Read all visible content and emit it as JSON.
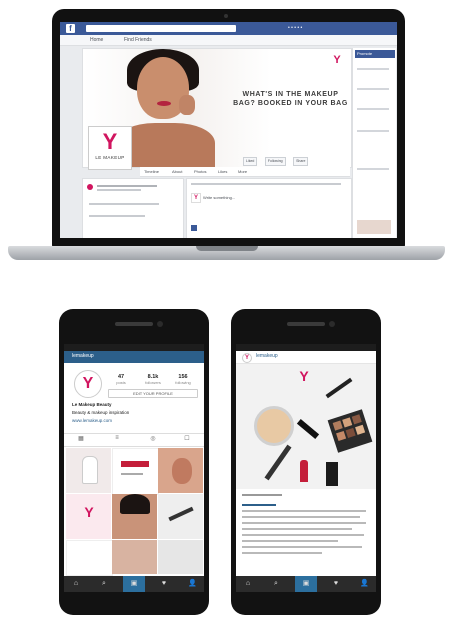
{
  "laptop": {
    "facebook": {
      "logo": "f",
      "headline": "WHAT'S IN THE MAKEUP BAG? BOOKED IN YOUR BAG",
      "brand_logo": "Y",
      "brand_name": "LE MAKEUP",
      "cover_buttons": [
        "Liked",
        "Following",
        "Share"
      ],
      "subnav": [
        "Home",
        "Find Friends"
      ],
      "tabs": [
        "Timeline",
        "About",
        "Photos",
        "Likes",
        "More"
      ],
      "status_placeholder": "Write something...",
      "sidebar_header": "Promote"
    }
  },
  "phone_left": {
    "header_username": "lemakeup",
    "profile_logo": "Y",
    "stats": [
      {
        "num": "47",
        "label": "posts"
      },
      {
        "num": "8.1k",
        "label": "followers"
      },
      {
        "num": "156",
        "label": "following"
      }
    ],
    "button_label": "EDIT YOUR PROFILE",
    "bio_lines": [
      "Le Makeup Beauty",
      "Beauty & makeup inspiration",
      "www.lemakeup.com"
    ],
    "tab_icons": [
      "▦",
      "≡",
      "◎",
      "☐"
    ]
  },
  "phone_right": {
    "header_username": "lemakeup",
    "post_logo": "Y"
  },
  "nav_icons": [
    "⌂",
    "⌕",
    "▣",
    "♥",
    "👤"
  ],
  "colors": {
    "facebook_blue": "#3b5998",
    "instagram_blue": "#2c5f8a",
    "brand_pink": "#d1155f"
  }
}
